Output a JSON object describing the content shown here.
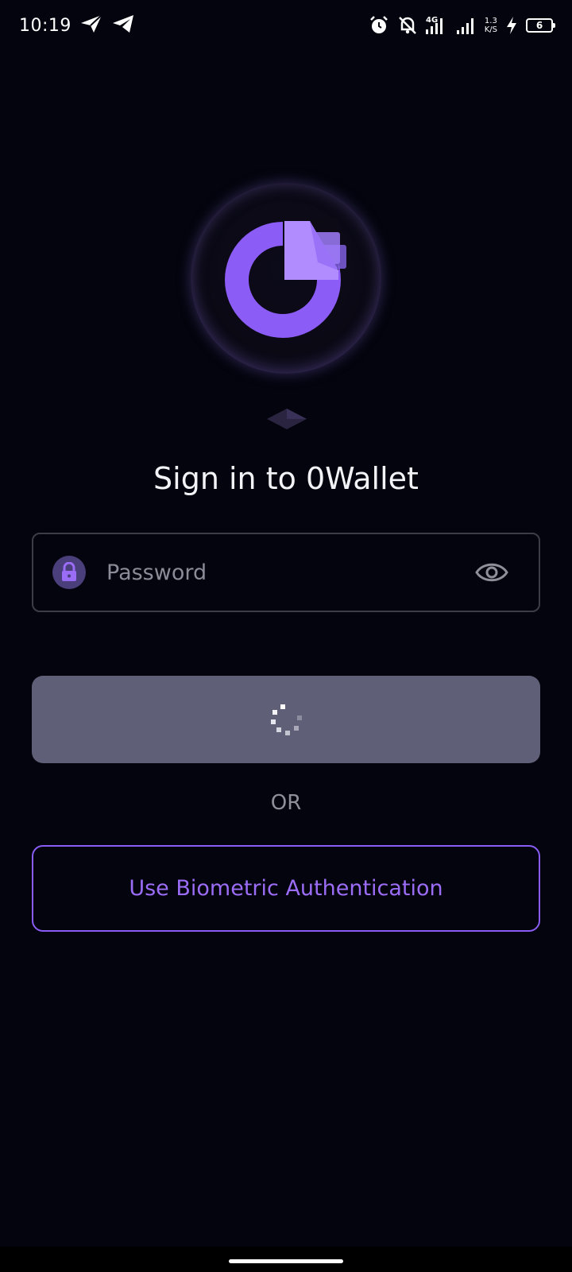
{
  "status_bar": {
    "time": "10:19",
    "net_speed_value": "1.3",
    "net_speed_unit": "K/S",
    "network_type": "4G",
    "battery_level": "6"
  },
  "app": {
    "title": "Sign in to 0Wallet",
    "accent_color": "#8a5cf6"
  },
  "password": {
    "placeholder": "Password"
  },
  "divider": {
    "label": "OR"
  },
  "biometric": {
    "label": "Use Biometric Authentication"
  }
}
